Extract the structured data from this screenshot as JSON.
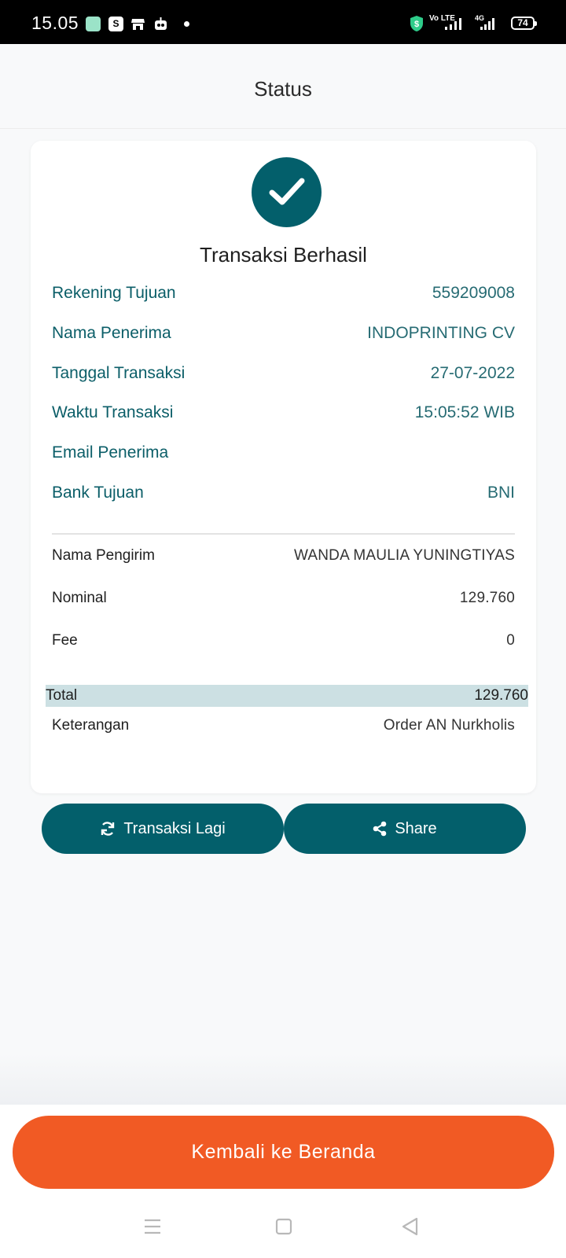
{
  "status_bar": {
    "time": "15.05",
    "app_icons": [
      "gallery-icon",
      "shopee-icon",
      "store-icon",
      "robot-icon"
    ],
    "network_label": "Vo LTE",
    "network_type": "4G",
    "battery": "74"
  },
  "header": {
    "title": "Status"
  },
  "result": {
    "title": "Transaksi Berhasil",
    "accent_color": "#035f6b"
  },
  "recipient_details": [
    {
      "label": "Rekening Tujuan",
      "value": "559209008"
    },
    {
      "label": "Nama Penerima",
      "value": "INDOPRINTING CV"
    },
    {
      "label": "Tanggal Transaksi",
      "value": "27-07-2022"
    },
    {
      "label": "Waktu Transaksi",
      "value": "15:05:52 WIB"
    },
    {
      "label": "Email Penerima",
      "value": ""
    },
    {
      "label": "Bank Tujuan",
      "value": "BNI"
    }
  ],
  "payment_details": {
    "sender": {
      "label": "Nama Pengirim",
      "value": "WANDA MAULIA YUNINGTIYAS"
    },
    "amount": {
      "label": "Nominal",
      "value": "129.760"
    },
    "fee": {
      "label": "Fee",
      "value": "0"
    },
    "total": {
      "label": "Total",
      "value": "129.760"
    },
    "note": {
      "label": "Keterangan",
      "value": "Order AN Nurkholis"
    }
  },
  "actions": {
    "repeat_label": "Transaksi Lagi",
    "share_label": "Share",
    "home_label": "Kembali ke Beranda",
    "home_color": "#f15a24"
  }
}
